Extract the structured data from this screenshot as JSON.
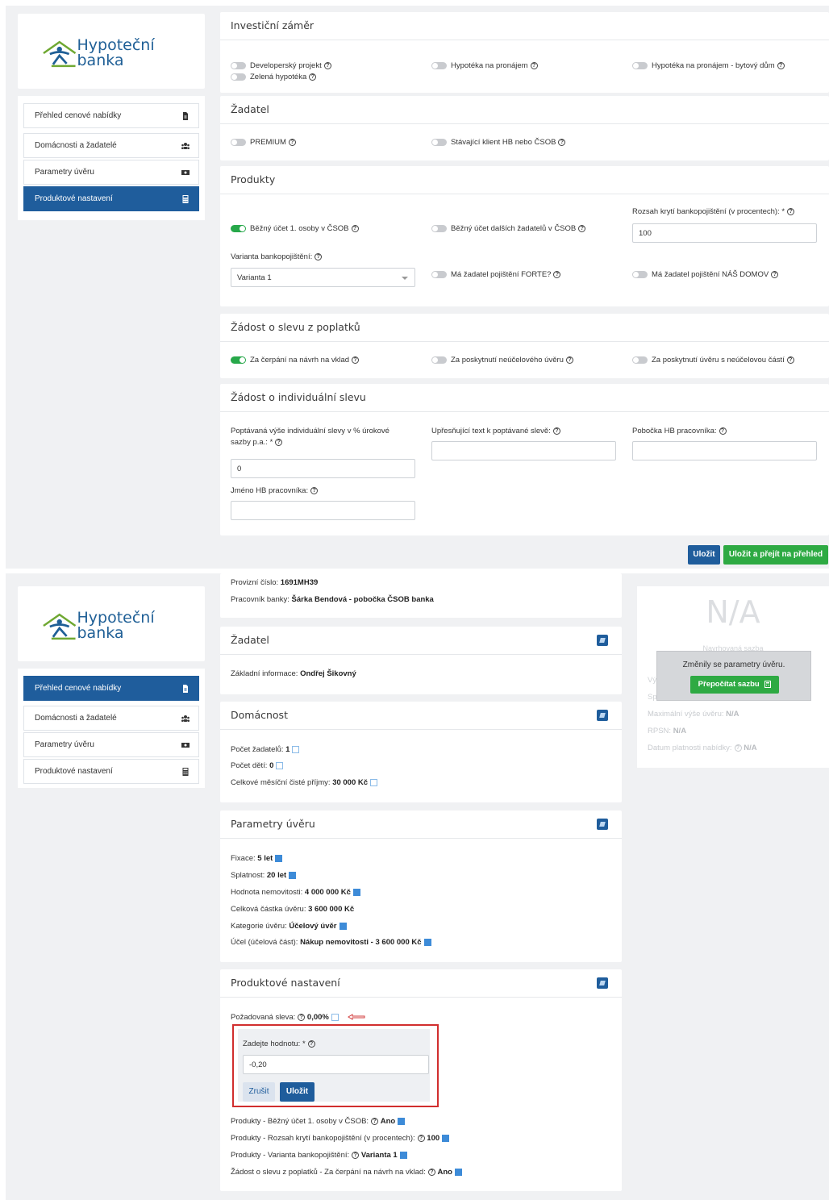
{
  "brand": {
    "name": "Hypoteční banka"
  },
  "screen1": {
    "menu": [
      {
        "label": "Přehled cenové nabídky",
        "icon": "document-icon",
        "active": false
      },
      {
        "label": "Domácnosti a žadatelé",
        "icon": "users-icon",
        "active": false
      },
      {
        "label": "Parametry úvěru",
        "icon": "money-icon",
        "active": false
      },
      {
        "label": "Produktové nastavení",
        "icon": "calculator-icon",
        "active": true
      }
    ],
    "investicni": {
      "title": "Investiční záměr",
      "t1": "Developerský projekt",
      "t2": "Zelená hypotéka",
      "t3": "Hypotéka na pronájem",
      "t4": "Hypotéka na pronájem - bytový dům"
    },
    "zadatel": {
      "title": "Žadatel",
      "t1": "PREMIUM",
      "t2": "Stávající klient HB nebo ČSOB"
    },
    "produkty": {
      "title": "Produkty",
      "t1": "Běžný účet 1. osoby v ČSOB",
      "t2": "Běžný účet dalších žadatelů v ČSOB",
      "rozsah_label": "Rozsah krytí bankopojištění (v procentech): *",
      "rozsah_value": "100",
      "varianta_label": "Varianta bankopojištění:",
      "varianta_value": "Varianta 1",
      "t3": "Má žadatel pojištění FORTE?",
      "t4": "Má žadatel pojištění NÁŠ DOMOV"
    },
    "sleva": {
      "title": "Žádost o slevu z poplatků",
      "t1": "Za čerpání na návrh na vklad",
      "t2": "Za poskytnutí neúčelového úvěru",
      "t3": "Za poskytnutí úvěru s neúčelovou částí"
    },
    "individualni": {
      "title": "Žádost o individuální slevu",
      "f1_label_a": "Poptávaná výše individuální slevy v % úrokové",
      "f1_label_b": "sazby p.a.: *",
      "f1_value": "0",
      "f2_label": "Upřesňující text k poptávané slevě:",
      "f3_label": "Pobočka HB pracovníka:",
      "f4_label": "Jméno HB pracovníka:"
    },
    "buttons": {
      "save": "Uložit",
      "save_go": "Uložit a přejít na přehled"
    }
  },
  "screen2": {
    "menu": [
      {
        "label": "Přehled cenové nabídky",
        "icon": "document-icon",
        "active": true
      },
      {
        "label": "Domácnosti a žadatelé",
        "icon": "users-icon",
        "active": false
      },
      {
        "label": "Parametry úvěru",
        "icon": "money-icon",
        "active": false
      },
      {
        "label": "Produktové nastavení",
        "icon": "calculator-icon",
        "active": false
      }
    ],
    "top": {
      "provizni_label": "Provizní číslo:",
      "provizni_value": "1691MH39",
      "pracovnik_label": "Pracovník banky:",
      "pracovnik_value": "Šárka Bendová - pobočka ČSOB banka"
    },
    "zadatel": {
      "title": "Žadatel",
      "label": "Základní informace:",
      "value": "Ondřej Šikovný"
    },
    "domacnost": {
      "title": "Domácnost",
      "r1_label": "Počet žadatelů:",
      "r1_value": "1",
      "r2_label": "Počet dětí:",
      "r2_value": "0",
      "r3_label": "Celkové měsíční čisté příjmy:",
      "r3_value": "30 000 Kč"
    },
    "parametry": {
      "title": "Parametry úvěru",
      "r1_label": "Fixace:",
      "r1_value": "5 let",
      "r2_label": "Splatnost:",
      "r2_value": "20 let",
      "r3_label": "Hodnota nemovitosti:",
      "r3_value": "4 000 000 Kč",
      "r4_label": "Celková částka úvěru:",
      "r4_value": "3 600 000 Kč",
      "r5_label": "Kategorie úvěru:",
      "r5_value": "Účelový úvěr",
      "r6_label": "Účel (účelová část):",
      "r6_value": "Nákup nemovitosti - 3 600 000 Kč"
    },
    "produktove": {
      "title": "Produktové nastavení",
      "sleva_label": "Požadovaná sleva:",
      "sleva_value": "0,00%",
      "edit_label": "Zadejte hodnotu: *",
      "edit_value": "-0,20",
      "cancel": "Zrušit",
      "save": "Uložit",
      "r1_label": "Produkty - Běžný účet 1. osoby v ČSOB:",
      "r1_value": "Ano",
      "r2_label": "Produkty - Rozsah krytí bankopojištění (v procentech):",
      "r2_value": "100",
      "r3_label": "Produkty - Varianta bankopojištění:",
      "r3_value": "Varianta 1",
      "r4_label": "Žádost o slevu z poplatků - Za čerpání na návrh na vklad:",
      "r4_value": "Ano"
    },
    "summary": {
      "big": "N/A",
      "sub": "Navrhovaná sazba",
      "ghost1": "Vý",
      "ghost2": "Sp",
      "max_label": "Maximální výše úvěru:",
      "max_value": "N/A",
      "rpsn_label": "RPSN:",
      "rpsn_value": "N/A",
      "datum_label": "Datum platnosti nabídky:",
      "datum_value": "N/A",
      "notice": "Změnily se parametry úvěru.",
      "recalc": "Přepočítat sazbu"
    }
  }
}
